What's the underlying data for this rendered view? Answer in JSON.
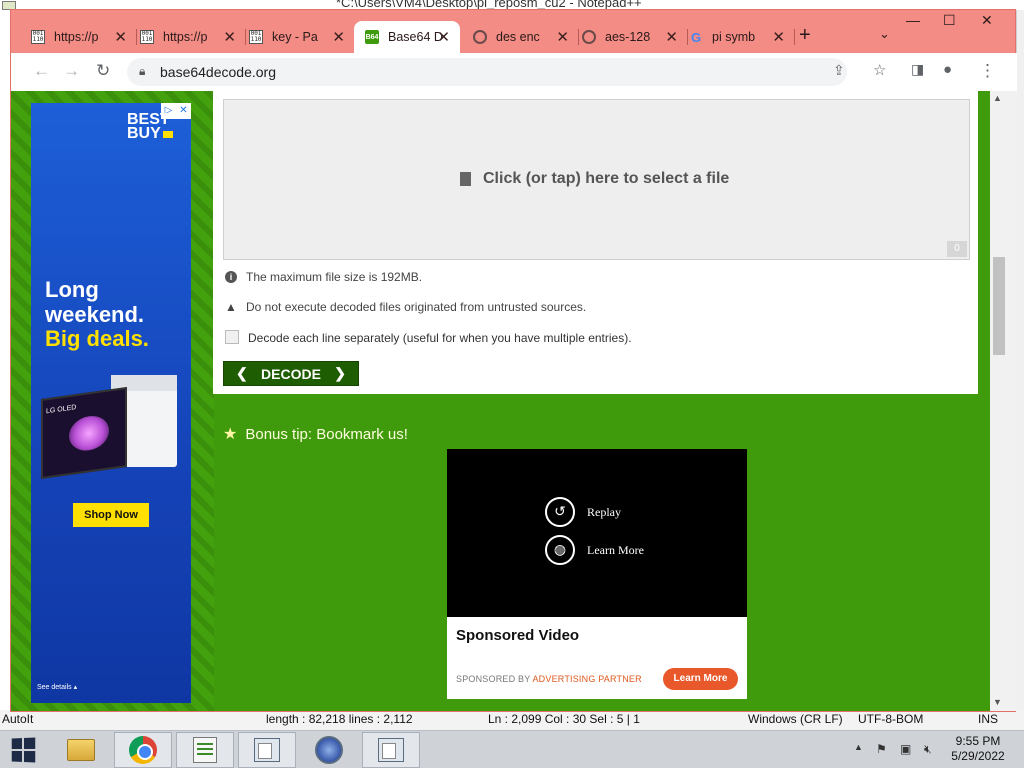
{
  "notepad": {
    "title": "*C:\\Users\\VM4\\Desktop\\pi_reposm_cu2 - Notepad++",
    "status": {
      "lang": "AutoIt",
      "length": "length : 82,218    lines : 2,112",
      "pos": "Ln : 2,099    Col : 30    Sel : 5 | 1",
      "eol": "Windows (CR LF)",
      "encoding": "UTF-8-BOM",
      "mode": "INS"
    }
  },
  "browser": {
    "tabs": [
      {
        "label": "https://p",
        "favicon": "doc-icon",
        "active": false
      },
      {
        "label": "https://p",
        "favicon": "doc-icon",
        "active": false
      },
      {
        "label": "key - Pa",
        "favicon": "doc-icon",
        "active": false
      },
      {
        "label": "Base64 D",
        "favicon": "base64-icon",
        "active": true
      },
      {
        "label": "des enc",
        "favicon": "globe-icon",
        "active": false
      },
      {
        "label": "aes-128",
        "favicon": "globe-icon",
        "active": false
      },
      {
        "label": "pi symb",
        "favicon": "google-icon",
        "active": false
      }
    ],
    "new_tab": "+",
    "address": "base64decode.org",
    "window_controls": {
      "minimize": "—",
      "maximize": "☐",
      "close": "✕"
    }
  },
  "page": {
    "dropzone_label": "Click (or tap) here to select a file",
    "file_count": "0",
    "max_size_note": "The maximum file size is 192MB.",
    "warning_note": "Do not execute decoded files originated from untrusted sources.",
    "decode_each_line_label": "Decode each line separately (useful for when you have multiple entries).",
    "decode_each_line_checked": false,
    "decode_button": "DECODE",
    "bonus_tip": "Bonus tip: Bookmark us!",
    "left_ad": {
      "logo": "BEST BUY",
      "line1": "Long",
      "line2": "weekend.",
      "line3": "Big deals.",
      "tv_brand": "LG OLED",
      "cta": "Shop Now",
      "footer": "See details ▴",
      "colors": {
        "background": "#1a52d0",
        "accent": "#ffe000"
      }
    },
    "video_ad": {
      "replay": "Replay",
      "learn_more_overlay": "Learn More",
      "title": "Sponsored Video",
      "sponsored_by": "SPONSORED BY",
      "partner": "ADVERTISING PARTNER",
      "cta": "Learn More"
    },
    "colors": {
      "site_green": "#3f9b0b",
      "decode_button": "#1f5d02"
    }
  },
  "taskbar": {
    "apps": [
      "start-icon",
      "file-explorer-icon",
      "chrome-icon",
      "notepad-plus-icon",
      "notepad-icon",
      "autoit-icon",
      "notepad-icon"
    ],
    "time": "9:55 PM",
    "date": "5/29/2022"
  }
}
